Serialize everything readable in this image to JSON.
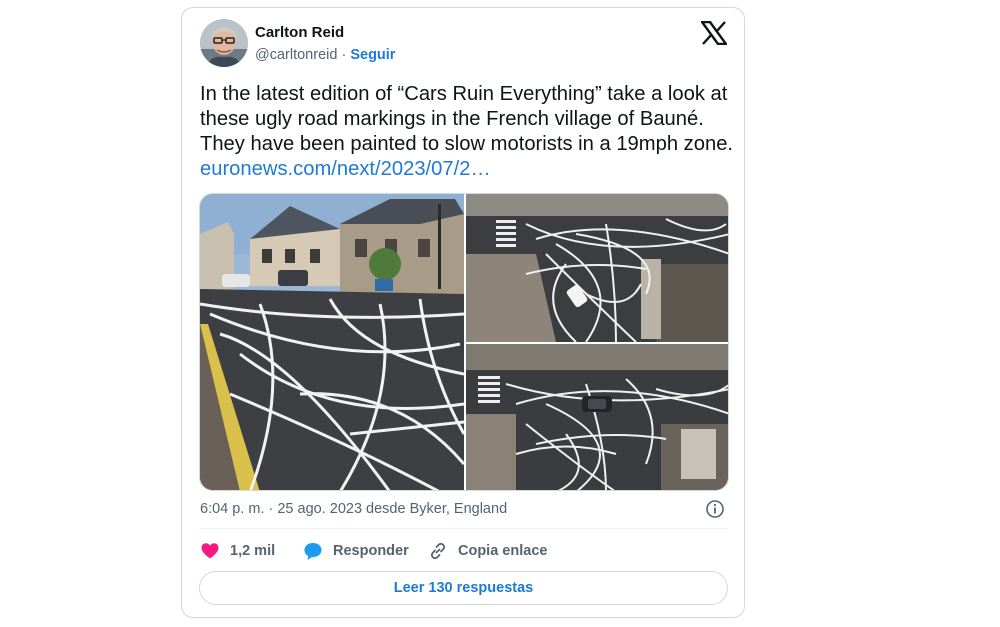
{
  "author": {
    "name": "Carlton Reid",
    "handle": "@carltonreid",
    "separator": "·",
    "follow_label": "Seguir"
  },
  "icons": {
    "brand": "x-logo-icon",
    "like": "heart-icon",
    "reply": "speech-bubble-icon",
    "copy": "link-icon",
    "info": "info-icon"
  },
  "tweet": {
    "text": "In the latest edition of “Cars Ruin Everything” take a look at these ugly road markings in the French village of Bauné. They have been painted to slow motorists in a 19mph zone.",
    "link_text": "euronews.com/next/2023/07/2…"
  },
  "media": [
    {
      "kind": "street-level photo of road markings"
    },
    {
      "kind": "aerial photo of intersection"
    },
    {
      "kind": "aerial photo of intersection with car"
    }
  ],
  "meta": {
    "timestamp": "6:04 p. m. · 25 ago. 2023 desde Byker, England"
  },
  "actions": {
    "likes_count": "1,2 mil",
    "reply_label": "Responder",
    "copy_label": "Copia enlace"
  },
  "footer": {
    "read_replies_label": "Leer 130 respuestas"
  },
  "colors": {
    "accent": "#1d7bd6",
    "like": "#f91880",
    "reply": "#1d9bf0",
    "muted_text": "#536471",
    "border": "#cfd9de"
  }
}
